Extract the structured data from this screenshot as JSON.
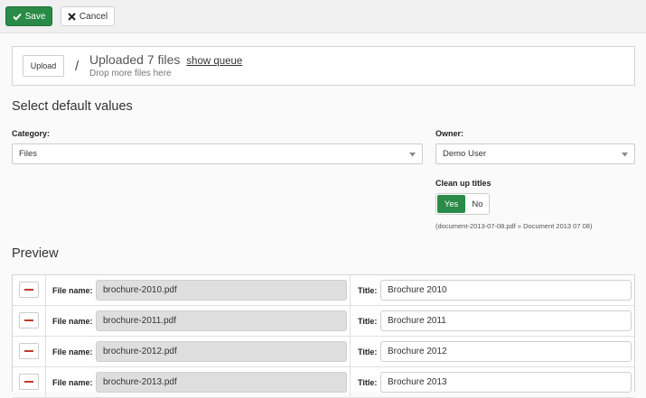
{
  "toolbar": {
    "save_label": "Save",
    "cancel_label": "Cancel"
  },
  "upload": {
    "button_label": "Upload",
    "separator": "/",
    "title": "Uploaded 7 files",
    "show_queue_link": "show queue",
    "hint": "Drop more files here"
  },
  "defaults": {
    "heading": "Select default values",
    "category": {
      "label": "Category:",
      "value": "Files"
    },
    "owner": {
      "label": "Owner:",
      "value": "Demo User"
    },
    "clean_titles": {
      "label": "Clean up titles",
      "yes_label": "Yes",
      "no_label": "No",
      "selected": "Yes",
      "example": "(document-2013-07-08.pdf » Document 2013 07 08)"
    }
  },
  "preview": {
    "heading": "Preview",
    "file_name_label": "File name:",
    "title_label": "Title:",
    "rows": [
      {
        "file_name": "brochure-2010.pdf",
        "title": "Brochure 2010"
      },
      {
        "file_name": "brochure-2011.pdf",
        "title": "Brochure 2011"
      },
      {
        "file_name": "brochure-2012.pdf",
        "title": "Brochure 2012"
      },
      {
        "file_name": "brochure-2013.pdf",
        "title": "Brochure 2013"
      }
    ]
  },
  "colors": {
    "accent": "#2a8a47",
    "danger": "#c0392b",
    "background": "#fafafa"
  }
}
